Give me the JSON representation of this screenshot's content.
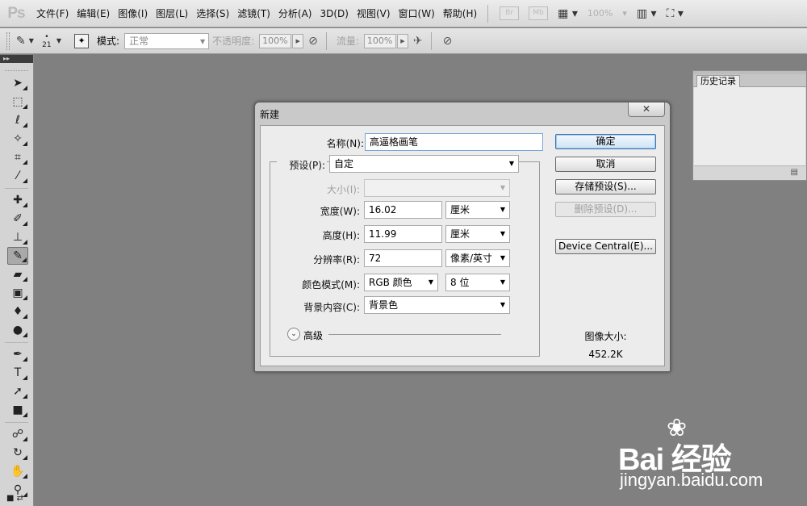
{
  "app": {
    "logo": "Ps"
  },
  "menubar": {
    "items": [
      "文件(F)",
      "编辑(E)",
      "图像(I)",
      "图层(L)",
      "选择(S)",
      "滤镜(T)",
      "分析(A)",
      "3D(D)",
      "视图(V)",
      "窗口(W)",
      "帮助(H)"
    ],
    "bridge_badge": "Br",
    "minibridge_badge": "Mb",
    "zoom": "100%"
  },
  "options_bar": {
    "brush_size": "21",
    "mode_label": "模式:",
    "mode_value": "正常",
    "opacity_label": "不透明度:",
    "opacity_value": "100%",
    "flow_label": "流量:",
    "flow_value": "100%"
  },
  "history_panel": {
    "tab_label": "历史记录"
  },
  "dialog": {
    "title": "新建",
    "name_label": "名称(N):",
    "name_value": "高逼格画笔",
    "preset_label": "预设(P):",
    "preset_value": "自定",
    "size_label": "大小(I):",
    "size_value": "",
    "width_label": "宽度(W):",
    "width_value": "16.02",
    "width_unit": "厘米",
    "height_label": "高度(H):",
    "height_value": "11.99",
    "height_unit": "厘米",
    "resolution_label": "分辨率(R):",
    "resolution_value": "72",
    "resolution_unit": "像素/英寸",
    "color_mode_label": "颜色模式(M):",
    "color_mode_value": "RGB 颜色",
    "bit_depth_value": "8 位",
    "background_label": "背景内容(C):",
    "background_value": "背景色",
    "advanced_label": "高级",
    "buttons": {
      "ok": "确定",
      "cancel": "取消",
      "save_preset": "存储预设(S)...",
      "delete_preset": "删除预设(D)...",
      "device_central": "Device Central(E)..."
    },
    "image_size_label": "图像大小:",
    "image_size_value": "452.2K"
  },
  "watermark": {
    "brand": "Bai 经验",
    "url": "jingyan.baidu.com"
  },
  "colors": {
    "workspace": "#808080",
    "default_button_border": "#3b78b5"
  }
}
